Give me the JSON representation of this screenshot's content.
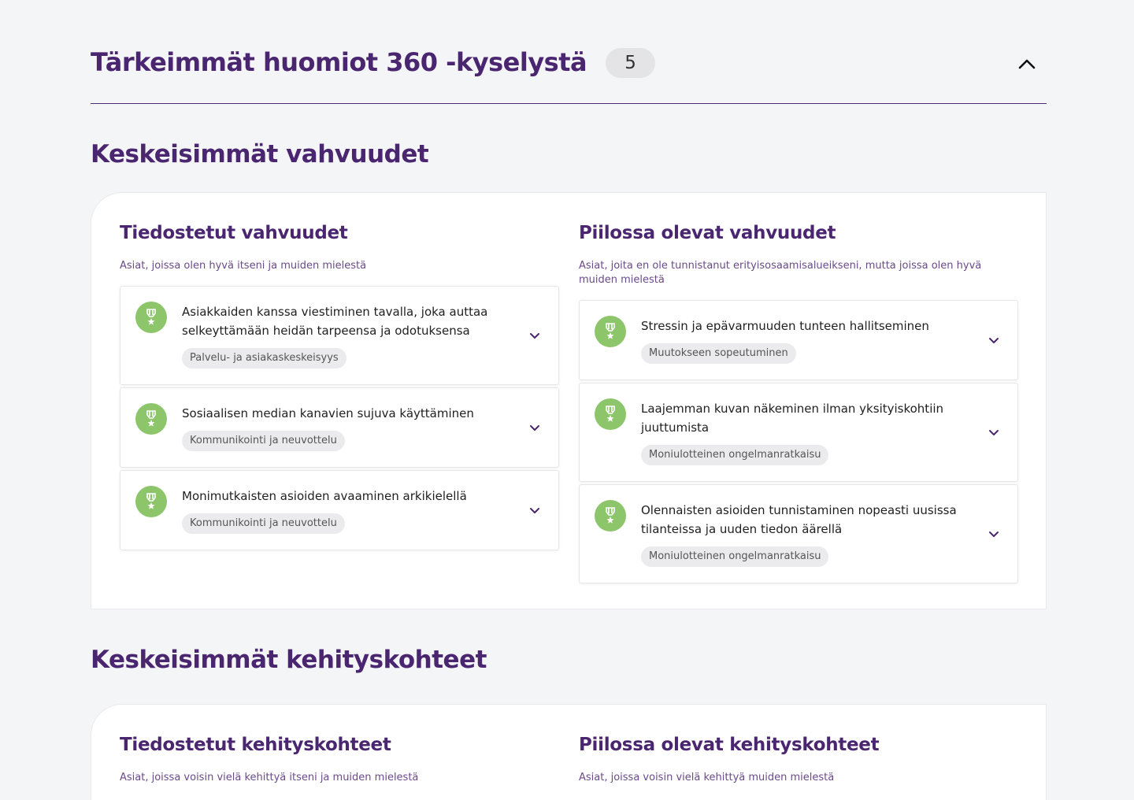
{
  "header": {
    "title": "Tärkeimmät huomiot 360 -kyselystä",
    "count": "5"
  },
  "strengths": {
    "title": "Keskeisimmät vahvuudet",
    "known": {
      "title": "Tiedostetut vahvuudet",
      "subtitle": "Asiat, joissa olen hyvä itseni ja muiden mielestä",
      "items": [
        {
          "text": "Asiakkaiden kanssa viestiminen tavalla, joka auttaa selkeyttämään heidän tarpeensa ja odotuksensa",
          "tag": "Palvelu- ja asiakaskeskeisyys"
        },
        {
          "text": "Sosiaalisen median kanavien sujuva käyttäminen",
          "tag": "Kommunikointi ja neuvottelu"
        },
        {
          "text": "Monimutkaisten asioiden avaaminen arkikielellä",
          "tag": "Kommunikointi ja neuvottelu"
        }
      ]
    },
    "hidden": {
      "title": "Piilossa olevat vahvuudet",
      "subtitle": "Asiat, joita en ole tunnistanut erityisosaamisalueikseni, mutta joissa olen hyvä muiden mielestä",
      "items": [
        {
          "text": "Stressin ja epävarmuuden tunteen hallitseminen",
          "tag": "Muutokseen sopeutuminen"
        },
        {
          "text": "Laajemman kuvan näkeminen ilman yksityiskohtiin juuttumista",
          "tag": "Moniulotteinen ongelmanratkaisu"
        },
        {
          "text": "Olennaisten asioiden tunnistaminen nopeasti uusissa tilanteissa ja uuden tiedon äärellä",
          "tag": "Moniulotteinen ongelmanratkaisu"
        }
      ]
    }
  },
  "development": {
    "title": "Keskeisimmät kehityskohteet",
    "known": {
      "title": "Tiedostetut kehityskohteet",
      "subtitle": "Asiat, joissa voisin vielä kehittyä itseni ja muiden mielestä"
    },
    "hidden": {
      "title": "Piilossa olevat kehityskohteet",
      "subtitle": "Asiat, joissa voisin vielä kehittyä muiden mielestä"
    }
  },
  "colors": {
    "brand_purple": "#4b2670",
    "medal_green": "#8cc56a",
    "background": "#f4f5f7"
  },
  "icons": {
    "medal": "medal-icon",
    "expand": "chevron-down-icon",
    "collapse": "chevron-up-icon"
  }
}
